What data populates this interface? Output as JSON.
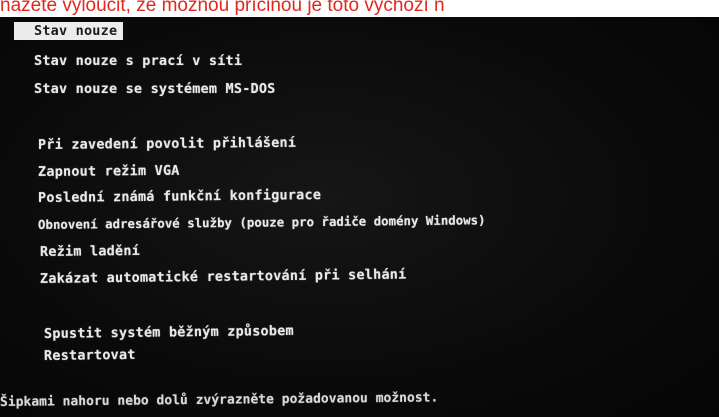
{
  "caption": "nažete vyloučit, že možnou příčinou je toto výchozí n",
  "menu": {
    "items": [
      "Stav nouze",
      "Stav nouze s prací v síti",
      "Stav nouze se systémem MS-DOS",
      "Při zavedení povolit přihlášení",
      "Zapnout režim VGA",
      "Poslední známá funkční konfigurace",
      "Obnovení adresářové služby (pouze pro řadiče domény Windows)",
      "Režim ladění",
      "Zakázat automatické restartování při selhání",
      "Spustit systém běžným způsobem",
      "Restartovat"
    ],
    "selected_index": 0
  },
  "hint": "Šipkami nahoru nebo dolů zvýrazněte požadovanou možnost.",
  "colors": {
    "caption_text": "#e0281f",
    "screen_background": "#0b0b0b",
    "menu_text": "#e9e9ec",
    "selection_background": "#ececec",
    "selection_text": "#1a1a1a"
  }
}
